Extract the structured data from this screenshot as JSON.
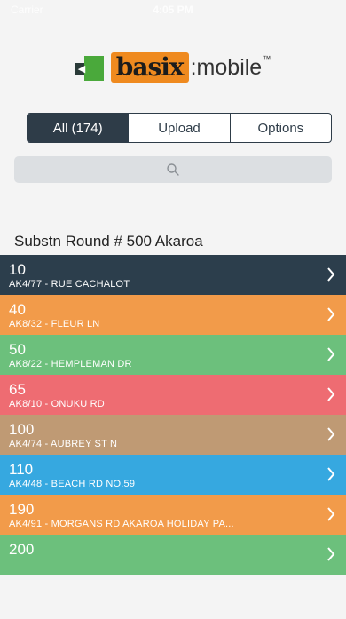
{
  "status": {
    "carrier": "Carrier",
    "time": "4:05 PM"
  },
  "logo": {
    "brand": "basix",
    "suffix": ":mobile",
    "tm": "™"
  },
  "tabs": [
    {
      "label": "All (174)",
      "active": true
    },
    {
      "label": "Upload",
      "active": false
    },
    {
      "label": "Options",
      "active": false
    }
  ],
  "search": {
    "placeholder": "",
    "icon": "search-icon"
  },
  "section": {
    "title": "Substn Round #  500 Akaroa"
  },
  "rows": [
    {
      "number": "10",
      "address": "AK4/77 - RUE CACHALOT",
      "color": "#2c3e4c"
    },
    {
      "number": "40",
      "address": "AK8/32 - FLEUR LN",
      "color": "#f29b4a"
    },
    {
      "number": "50",
      "address": "AK8/22 - HEMPLEMAN DR",
      "color": "#6cc07c"
    },
    {
      "number": "65",
      "address": "AK8/10 - ONUKU RD",
      "color": "#ee6c72"
    },
    {
      "number": "100",
      "address": "AK4/74 - AUBREY ST N",
      "color": "#bf9a74"
    },
    {
      "number": "110",
      "address": "AK4/48 - BEACH RD NO.59",
      "color": "#36a8e0"
    },
    {
      "number": "190",
      "address": "AK4/91 - MORGANS RD AKAROA HOLIDAY PA...",
      "color": "#f29b4a"
    },
    {
      "number": "200",
      "address": "",
      "color": "#6cc07c"
    }
  ]
}
